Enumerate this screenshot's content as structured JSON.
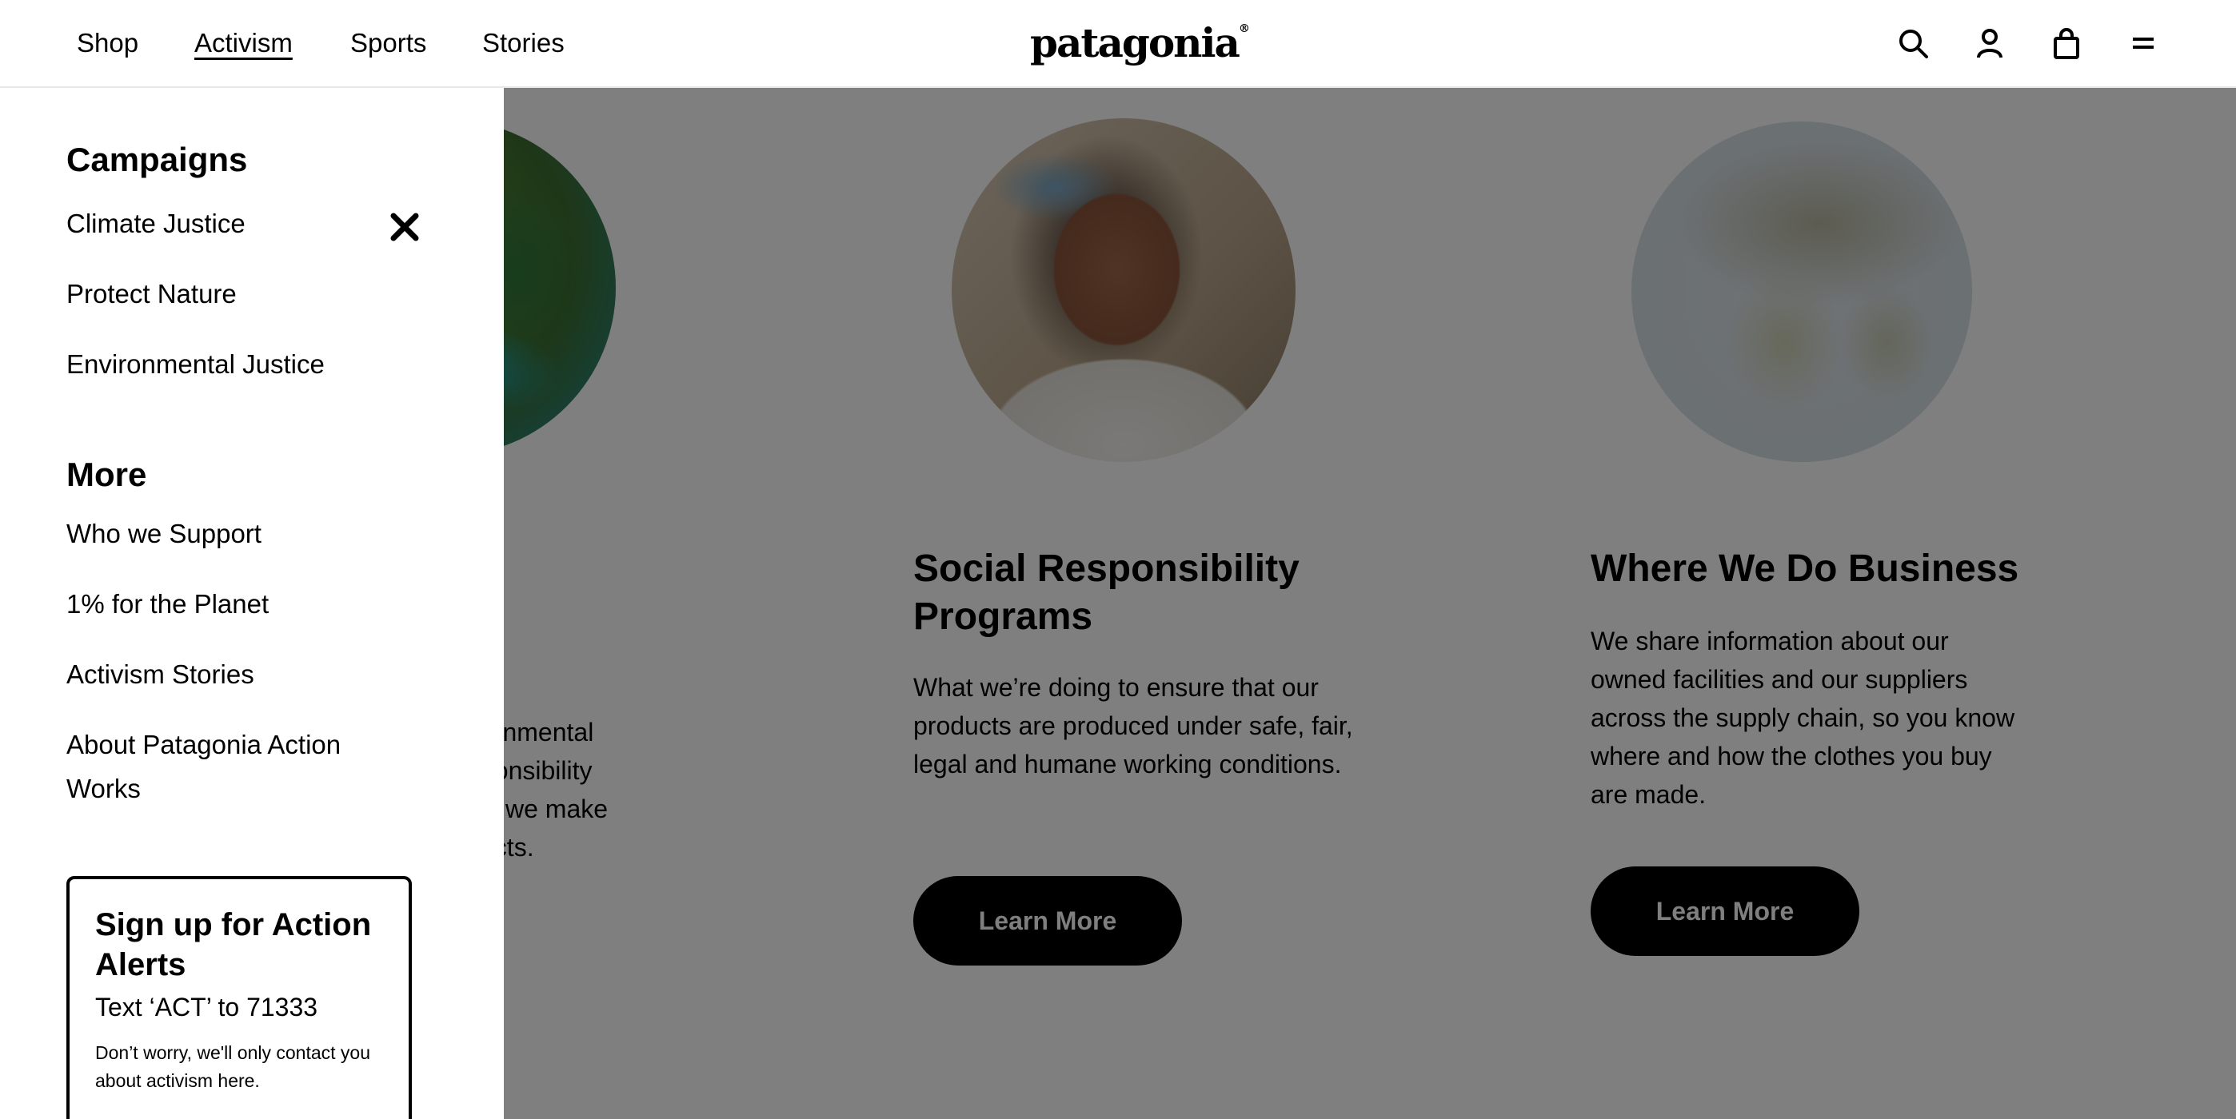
{
  "header": {
    "nav": [
      {
        "label": "Shop"
      },
      {
        "label": "Activism"
      },
      {
        "label": "Sports"
      },
      {
        "label": "Stories"
      }
    ],
    "logo_text": "patagonia",
    "icons": [
      "search-icon",
      "account-icon",
      "cart-icon",
      "menu-icon"
    ]
  },
  "drawer": {
    "campaigns_title": "Campaigns",
    "campaigns": [
      {
        "label": "Climate Justice"
      },
      {
        "label": "Protect Nature"
      },
      {
        "label": "Environmental Justice"
      }
    ],
    "more_title": "More",
    "more": [
      {
        "label": "Who we Support"
      },
      {
        "label": "1% for the Planet"
      },
      {
        "label": "Activism Stories"
      },
      {
        "label": "About Patagonia Action Works"
      }
    ],
    "alert": {
      "title": "Sign up for Action Alerts",
      "text": "Text ‘ACT’ to 71333",
      "note": "Don’t worry, we'll only contact you about activism here."
    }
  },
  "page": {
    "left_column_partial_text": "ronmental\nponsibility\nw we make\nucts.",
    "columns": [
      {
        "title": "Social Responsibility Programs",
        "body": "What we’re doing to ensure that our products are produced under safe, fair, legal and humane working conditions.",
        "button": "Learn More"
      },
      {
        "title": "Where We Do Business",
        "body": "We share information about our owned facilities and our suppliers across the supply chain, so you know where and how the clothes you buy are made.",
        "button": "Learn More"
      }
    ]
  },
  "colors": {
    "overlay": "rgba(0,0,0,0.5)",
    "button_bg": "#000000",
    "text": "#000000"
  }
}
